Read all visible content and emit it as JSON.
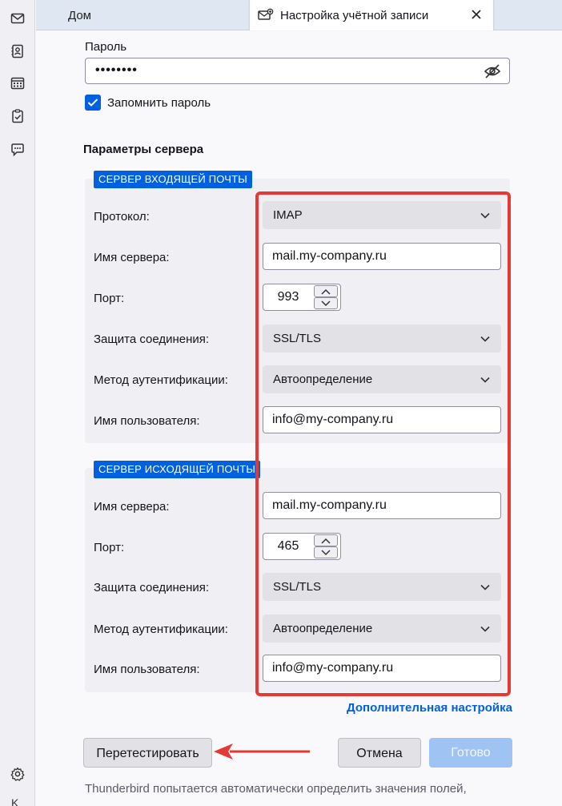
{
  "tabs": {
    "home_label": "Дом",
    "active_label": "Настройка учётной записи"
  },
  "password": {
    "label": "Пароль",
    "value": "••••••••",
    "remember_label": "Запомнить пароль",
    "remember_checked": true
  },
  "server_settings": {
    "heading": "Параметры сервера",
    "incoming": {
      "legend": "СЕРВЕР ВХОДЯЩЕЙ ПОЧТЫ",
      "protocol_label": "Протокол:",
      "protocol_value": "IMAP",
      "hostname_label": "Имя сервера:",
      "hostname_value": "mail.my-company.ru",
      "port_label": "Порт:",
      "port_value": "993",
      "security_label": "Защита соединения:",
      "security_value": "SSL/TLS",
      "auth_label": "Метод аутентификации:",
      "auth_value": "Автоопределение",
      "username_label": "Имя пользователя:",
      "username_value": "info@my-company.ru"
    },
    "outgoing": {
      "legend": "СЕРВЕР ИСХОДЯЩЕЙ ПОЧТЫ",
      "hostname_label": "Имя сервера:",
      "hostname_value": "mail.my-company.ru",
      "port_label": "Порт:",
      "port_value": "465",
      "security_label": "Защита соединения:",
      "security_value": "SSL/TLS",
      "auth_label": "Метод аутентификации:",
      "auth_value": "Автоопределение",
      "username_label": "Имя пользователя:",
      "username_value": "info@my-company.ru"
    },
    "advanced_link": "Дополнительная настройка"
  },
  "buttons": {
    "retest": "Перетестировать",
    "cancel": "Отмена",
    "done": "Готово"
  },
  "footnote": "Thunderbird попытается автоматически определить значения полей,",
  "sidebar_letter": "K",
  "colors": {
    "accent": "#0061e0",
    "highlight": "#e53935",
    "done_disabled": "#9fc3f2"
  },
  "icons": [
    "mail-icon",
    "address-book-icon",
    "calendar-icon",
    "tasks-icon",
    "chat-icon",
    "settings-icon",
    "eye-off-icon",
    "chevron-down-icon",
    "close-icon",
    "mail-setup-icon"
  ]
}
